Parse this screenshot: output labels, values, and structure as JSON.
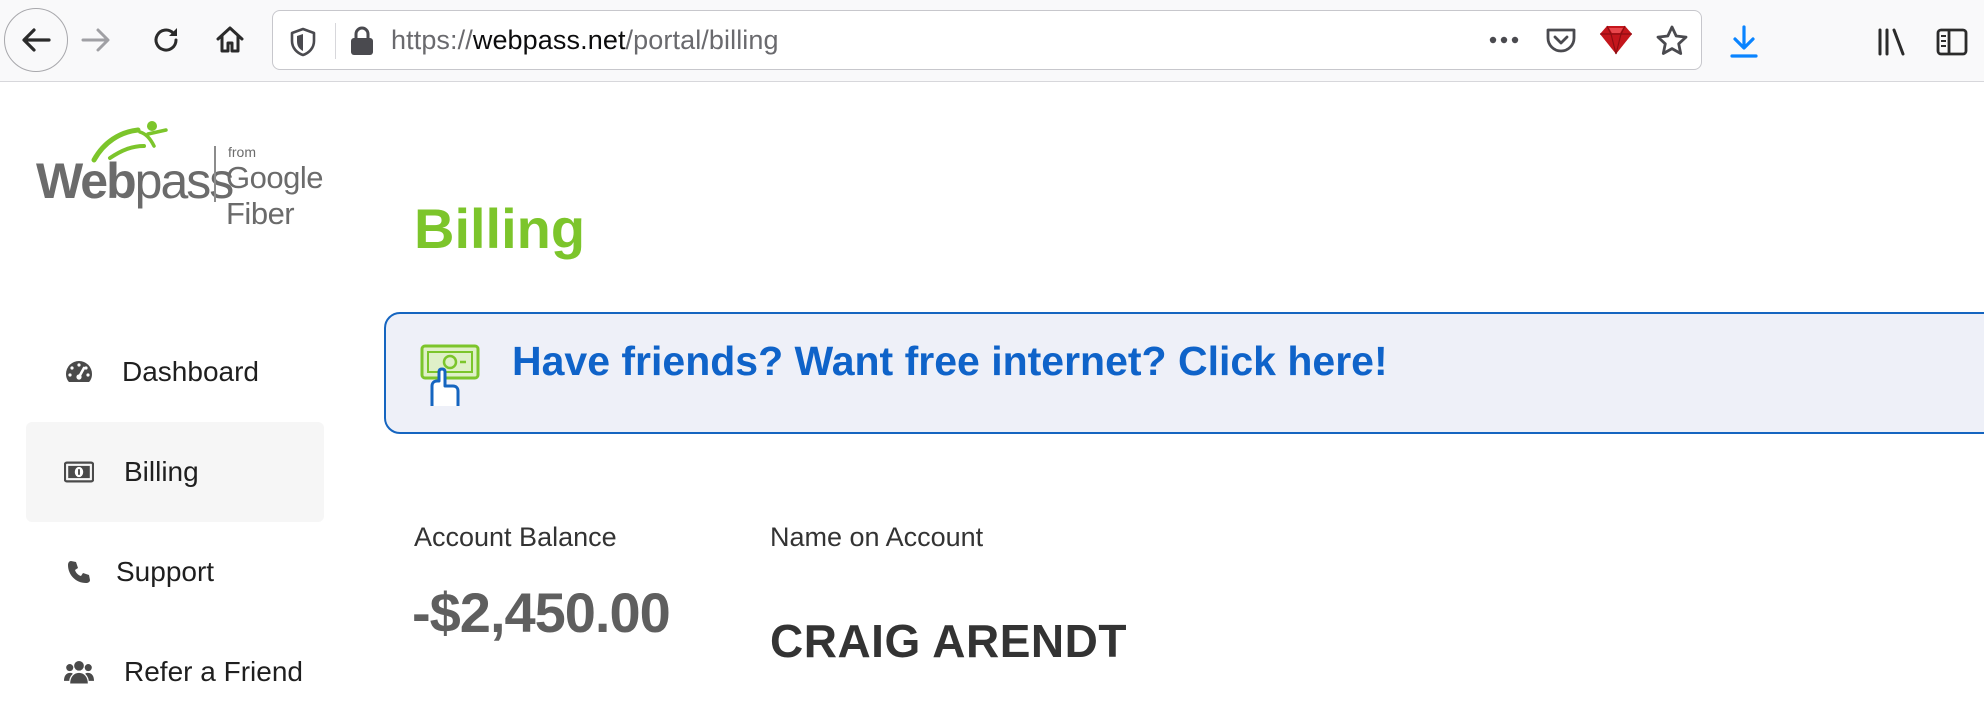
{
  "browser": {
    "url": {
      "scheme": "https://",
      "domain": "webpass.net",
      "path": "/portal/billing"
    },
    "icons": [
      "back-icon",
      "forward-icon",
      "reload-icon",
      "home-icon",
      "shield-icon",
      "lock-icon",
      "more-icon",
      "pocket-icon",
      "ruby-extension-icon",
      "bookmark-star-icon",
      "download-icon",
      "library-icon",
      "sidebar-icon"
    ]
  },
  "logo": {
    "brand_bold": "Web",
    "brand_light": "pass",
    "from": "from",
    "partner": "Google Fiber"
  },
  "nav": {
    "items": [
      {
        "label": "Dashboard",
        "icon": "dashboard-gauge-icon"
      },
      {
        "label": "Billing",
        "icon": "money-bill-icon",
        "active": true
      },
      {
        "label": "Support",
        "icon": "phone-icon"
      },
      {
        "label": "Refer a Friend",
        "icon": "users-icon"
      }
    ]
  },
  "main": {
    "title": "Billing",
    "banner": {
      "text": "Have friends? Want free internet? Click here!",
      "icon": "hand-money-icon"
    },
    "account_balance_label": "Account Balance",
    "account_balance_value": "-$2,450.00",
    "name_label": "Name on Account",
    "name_value": "CRAIG ARENDT"
  },
  "colors": {
    "accent_green": "#7cc52b",
    "banner_blue": "#0f63c9",
    "banner_bg": "#eef0f8",
    "toolbar_bg": "#f9f9fa",
    "download_blue": "#0a84ff"
  }
}
